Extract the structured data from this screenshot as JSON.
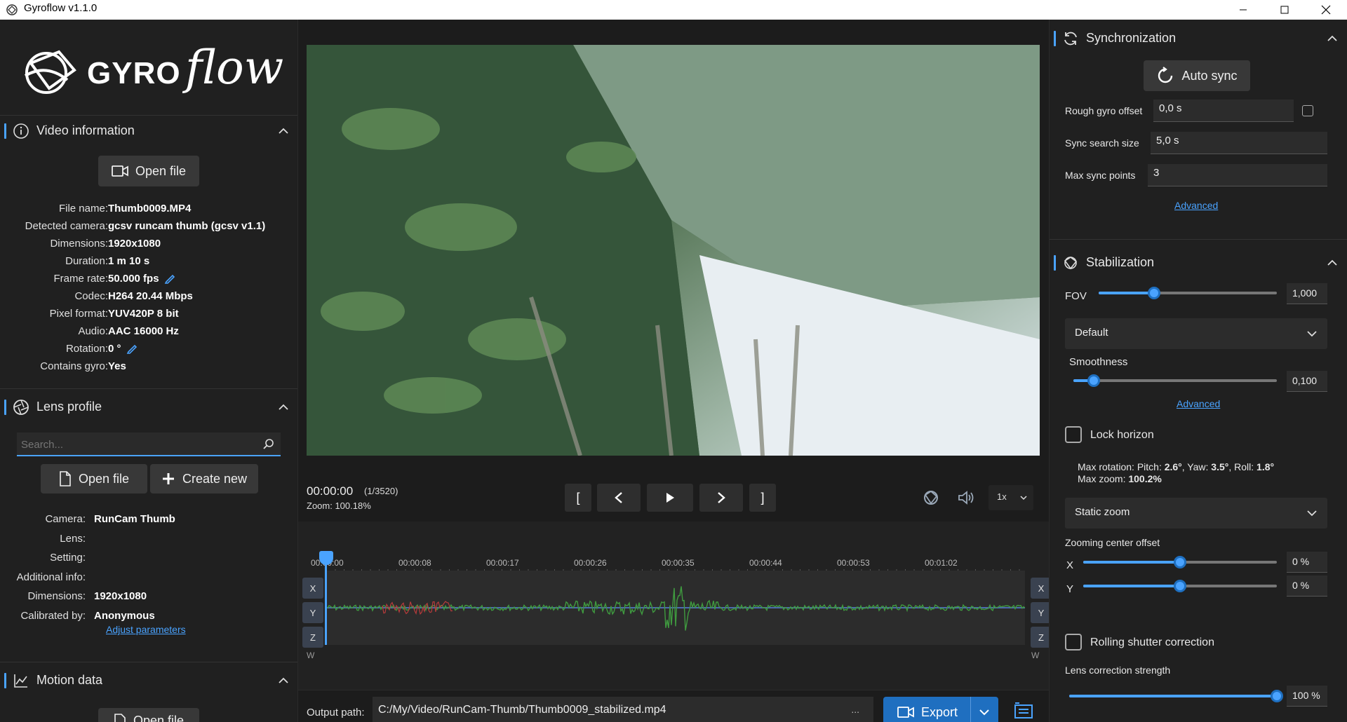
{
  "window": {
    "title": "Gyroflow v1.1.0"
  },
  "left": {
    "logo_text": "GYRO",
    "logo_script": "flow",
    "video_info": {
      "header": "Video information",
      "open_file": "Open file",
      "rows": [
        {
          "k": "File name:",
          "v": "Thumb0009.MP4"
        },
        {
          "k": "Detected camera:",
          "v": "gcsv runcam thumb (gcsv v1.1)"
        },
        {
          "k": "Dimensions:",
          "v": "1920x1080"
        },
        {
          "k": "Duration:",
          "v": "1 m 10 s"
        },
        {
          "k": "Frame rate:",
          "v": "50.000 fps"
        },
        {
          "k": "Codec:",
          "v": "H264 20.44 Mbps"
        },
        {
          "k": "Pixel format:",
          "v": "YUV420P 8 bit"
        },
        {
          "k": "Audio:",
          "v": "AAC 16000 Hz"
        },
        {
          "k": "Rotation:",
          "v": "0 °"
        },
        {
          "k": "Contains gyro:",
          "v": "Yes"
        }
      ]
    },
    "lens": {
      "header": "Lens profile",
      "search_placeholder": "Search...",
      "open_file": "Open file",
      "create_new": "Create new",
      "rows": [
        {
          "k": "Camera:",
          "v": "RunCam Thumb"
        },
        {
          "k": "Lens:",
          "v": ""
        },
        {
          "k": "Setting:",
          "v": ""
        },
        {
          "k": "Additional info:",
          "v": ""
        },
        {
          "k": "Dimensions:",
          "v": "1920x1080"
        },
        {
          "k": "Calibrated by:",
          "v": "Anonymous"
        }
      ],
      "adjust": "Adjust parameters"
    },
    "motion": {
      "header": "Motion data",
      "open_file": "Open file"
    }
  },
  "player": {
    "time": "00:00:00",
    "frame": "(1/3520)",
    "zoom": "Zoom: 100.18%",
    "speed": "1x",
    "marker_in": "[",
    "marker_out": "]",
    "ticks": [
      "00:00:00",
      "00:00:08",
      "00:00:17",
      "00:00:26",
      "00:00:35",
      "00:00:44",
      "00:00:53",
      "00:01:02"
    ],
    "axes": [
      "X",
      "Y",
      "Z"
    ],
    "w_label": "W",
    "output_label": "Output path:",
    "output_path": "C:/My/Video/RunCam-Thumb/Thumb0009_stabilized.mp4",
    "more": "...",
    "export": "Export"
  },
  "sync": {
    "header": "Synchronization",
    "auto_sync": "Auto sync",
    "rough_label": "Rough gyro offset",
    "rough_value": "0,0 s",
    "search_label": "Sync search size",
    "search_value": "5,0 s",
    "max_label": "Max sync points",
    "max_value": "3",
    "advanced": "Advanced"
  },
  "stab": {
    "header": "Stabilization",
    "fov_label": "FOV",
    "fov_value": "1,000",
    "fov_level": 0.31,
    "method": "Default",
    "smooth_label": "Smoothness",
    "smooth_value": "0,100",
    "smooth_level": 0.1,
    "advanced": "Advanced",
    "lock_horizon": "Lock horizon",
    "max_rotation_prefix": "Max rotation: Pitch: ",
    "pitch": "2.6°",
    "yaw_prefix": ", Yaw: ",
    "yaw": "3.5°",
    "roll_prefix": ", Roll: ",
    "roll": "1.8°",
    "max_zoom_prefix": "Max zoom: ",
    "max_zoom": "100.2%",
    "zoom_mode": "Static zoom",
    "zoom_center_label": "Zoom­ing center offset",
    "x_label": "X",
    "x_value": "0 %",
    "y_label": "Y",
    "y_value": "0 %",
    "rolling": "Rolling shutter correction",
    "lens_strength_label": "Lens correction strength",
    "lens_strength_value": "100 %",
    "lens_strength_level": 1.0
  },
  "colors": {
    "accent": "#4aa3ff",
    "panel": "#202020"
  }
}
